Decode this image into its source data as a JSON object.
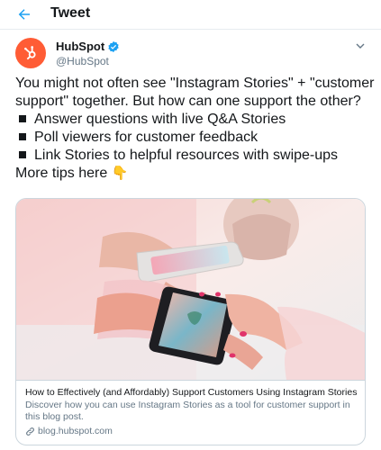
{
  "header": {
    "title": "Tweet",
    "back_icon": "arrow-left-icon"
  },
  "tweet": {
    "author": {
      "name": "HubSpot",
      "handle": "@HubSpot",
      "verified": true,
      "avatar_color": "#ff5c35"
    },
    "intro_line1": "You might not often see \"Instagram Stories\" + \"customer",
    "intro_line2": "support\" together. But how can one support the other?",
    "bullets": [
      "Answer questions with live Q&A Stories",
      "Poll viewers for customer feedback",
      "Link Stories to helpful resources with swipe-ups"
    ],
    "outro": "More tips here",
    "outro_emoji": "👇"
  },
  "card": {
    "title": "How to Effectively (and Affordably) Support Customers Using Instagram Stories",
    "description_line1": "Discover how you can use Instagram Stories as a tool for customer support in",
    "description_line2": "this blog post.",
    "domain": "blog.hubspot.com",
    "link_icon": "link-icon"
  },
  "colors": {
    "accent": "#1da1f2",
    "text": "#14171a",
    "muted": "#657786",
    "border": "#ccd6dd"
  }
}
